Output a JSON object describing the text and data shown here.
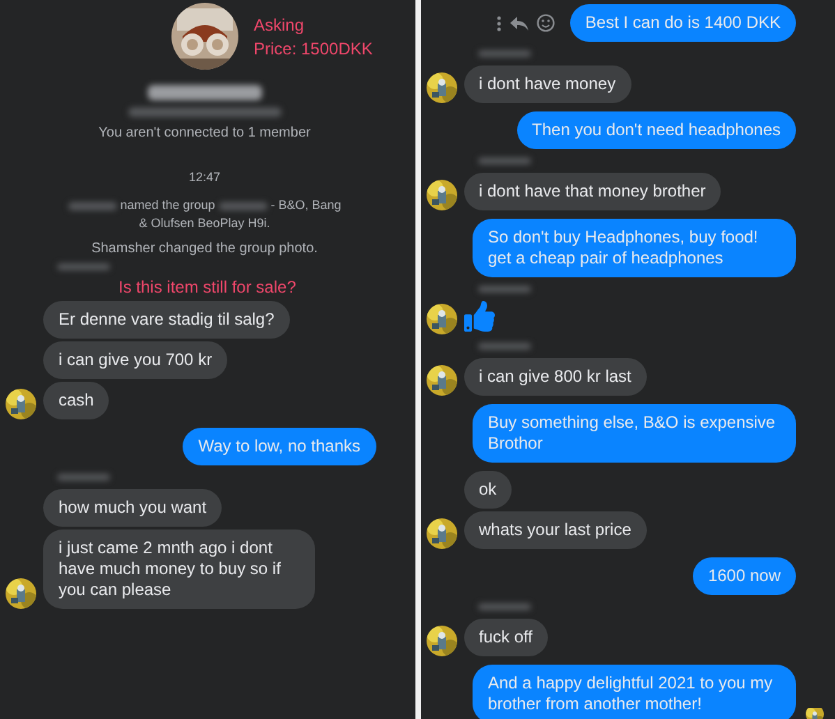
{
  "left_panel": {
    "caption": [
      "Asking",
      "Price: 1500DKK"
    ],
    "notices": [
      {
        "kind": "blurred_name"
      },
      {
        "kind": "blurred_line"
      },
      {
        "kind": "text",
        "text": "You aren't connected to 1 member"
      },
      {
        "kind": "time",
        "text": "12:47"
      },
      {
        "kind": "rename",
        "segments": [
          {
            "kind": "blur"
          },
          {
            "kind": "text",
            "text": "named the group"
          },
          {
            "kind": "blur"
          },
          {
            "kind": "text",
            "text": "- B&O, Bang & Olufsen BeoPlay H9i."
          }
        ]
      },
      {
        "kind": "text",
        "text": "Shamsher changed the group photo."
      }
    ],
    "messages": [
      {
        "outgoing": false,
        "kind": "text",
        "sender_label": true,
        "avatar": false,
        "annotation": "Is this item still for sale?",
        "text": "Er denne vare stadig til salg?"
      },
      {
        "outgoing": false,
        "kind": "text",
        "sender_label": false,
        "avatar": false,
        "text": "i can give you 700 kr"
      },
      {
        "outgoing": false,
        "kind": "text",
        "sender_label": false,
        "avatar": true,
        "text": "cash"
      },
      {
        "outgoing": true,
        "kind": "text",
        "text": "Way to low, no thanks"
      },
      {
        "outgoing": false,
        "kind": "text",
        "sender_label": true,
        "avatar": false,
        "text": "how much you want"
      },
      {
        "outgoing": false,
        "kind": "text",
        "sender_label": false,
        "avatar": true,
        "text": "i just came 2 mnth ago i dont have much money to buy so if you can please"
      }
    ]
  },
  "right_panel": {
    "messages": [
      {
        "outgoing": true,
        "kind": "text",
        "actions": true,
        "text": "Best I can do is 1400 DKK"
      },
      {
        "outgoing": false,
        "kind": "text",
        "sender_label": true,
        "avatar": true,
        "text": "i dont have money"
      },
      {
        "outgoing": true,
        "kind": "text",
        "text": "Then you don't need headphones"
      },
      {
        "outgoing": false,
        "kind": "text",
        "sender_label": true,
        "avatar": true,
        "text": "i dont have that money brother"
      },
      {
        "outgoing": true,
        "kind": "text",
        "text": "So don't buy Headphones, buy food! get a cheap pair of headphones"
      },
      {
        "outgoing": false,
        "kind": "like",
        "sender_label": true,
        "avatar": true
      },
      {
        "outgoing": false,
        "kind": "text",
        "sender_label": true,
        "avatar": true,
        "text": "i can give 800 kr last"
      },
      {
        "outgoing": true,
        "kind": "text",
        "text": "Buy something else, B&O is expensive Brothor"
      },
      {
        "outgoing": false,
        "kind": "text",
        "sender_label": false,
        "avatar": false,
        "text": "ok"
      },
      {
        "outgoing": false,
        "kind": "text",
        "sender_label": false,
        "avatar": true,
        "text": "whats your last price"
      },
      {
        "outgoing": true,
        "kind": "text",
        "text": "1600 now"
      },
      {
        "outgoing": false,
        "kind": "text",
        "sender_label": true,
        "avatar": true,
        "text": "fuck off"
      },
      {
        "outgoing": true,
        "kind": "text",
        "seen": true,
        "text": "And a happy delightful 2021 to you my brother from another mother!"
      }
    ]
  }
}
